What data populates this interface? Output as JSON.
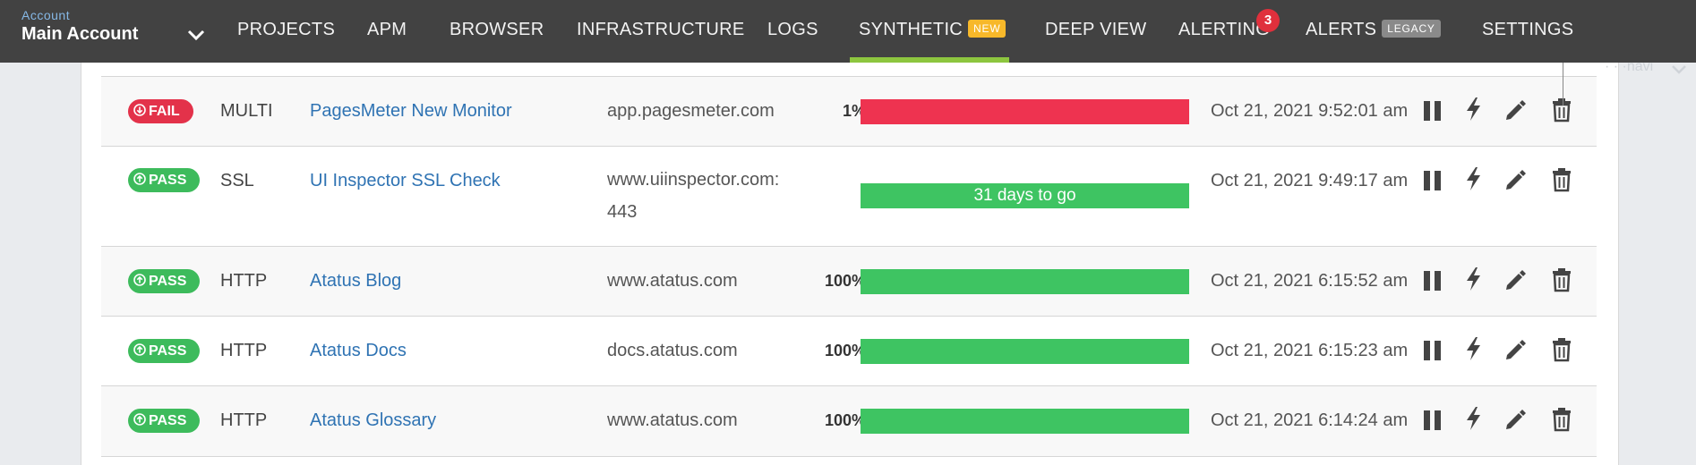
{
  "account": {
    "label": "Account",
    "name": "Main Account"
  },
  "nav": [
    {
      "label": "PROJECTS"
    },
    {
      "label": "APM"
    },
    {
      "label": "BROWSER"
    },
    {
      "label": "INFRASTRUCTURE"
    },
    {
      "label": "LOGS"
    },
    {
      "label": "SYNTHETIC",
      "tag": "NEW"
    },
    {
      "label": "DEEP VIEW"
    },
    {
      "label": "ALERTING",
      "badge": "3"
    },
    {
      "label": "ALERTS",
      "tag": "LEGACY"
    },
    {
      "label": "SETTINGS"
    }
  ],
  "faded_text": "· · ·navi",
  "monitors": [
    {
      "status": "FAIL",
      "type": "MULTI",
      "name": "PagesMeter New Monitor",
      "url": "app.pagesmeter.com",
      "pct": "1%",
      "bar_text": "",
      "time": "Oct 21, 2021 9:52:01 am"
    },
    {
      "status": "PASS",
      "type": "SSL",
      "name": "UI Inspector SSL Check",
      "url_line1": "www.uiinspector.com:",
      "url_line2": "443",
      "pct": "",
      "bar_text": "31 days to go",
      "time": "Oct 21, 2021 9:49:17 am"
    },
    {
      "status": "PASS",
      "type": "HTTP",
      "name": "Atatus Blog",
      "url": "www.atatus.com",
      "pct": "100%",
      "bar_text": "",
      "time": "Oct 21, 2021 6:15:52 am"
    },
    {
      "status": "PASS",
      "type": "HTTP",
      "name": "Atatus Docs",
      "url": "docs.atatus.com",
      "pct": "100%",
      "bar_text": "",
      "time": "Oct 21, 2021 6:15:23 am"
    },
    {
      "status": "PASS",
      "type": "HTTP",
      "name": "Atatus Glossary",
      "url": "www.atatus.com",
      "pct": "100%",
      "bar_text": "",
      "time": "Oct 21, 2021 6:14:24 am"
    }
  ],
  "colors": {
    "fail": "#e3324a",
    "pass": "#3dbb5c",
    "bar_fail": "#ee3350",
    "bar_pass": "#3ec462",
    "active_tab": "#8dc63f"
  },
  "icons": [
    "pause-icon",
    "bolt-icon",
    "pencil-icon",
    "trash-icon"
  ]
}
